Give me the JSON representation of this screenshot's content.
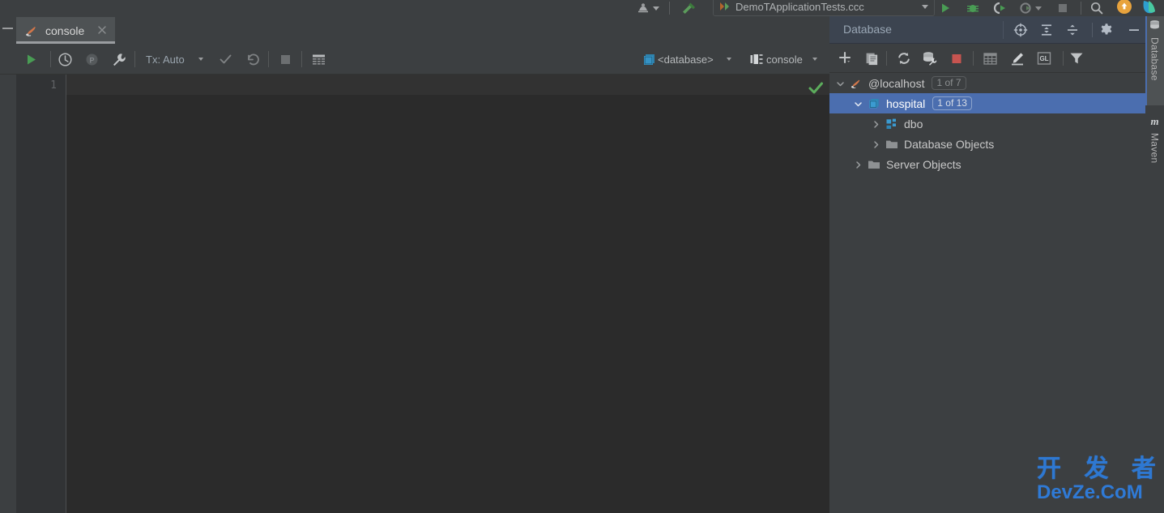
{
  "window": {
    "top_toolbar": {
      "profiler_icon": "profiler-icon",
      "build_icon": "build-hammer-icon",
      "run_config": {
        "name": "DemoTApplicationTests.ccc",
        "dropdown": "chevron-down-icon"
      },
      "run_icon": "run-icon",
      "debug_icon": "debug-icon",
      "coverage_icon": "run-with-coverage-icon",
      "profile_icon": "run-with-profiler-icon",
      "stop_icon": "stop-icon",
      "search_icon": "search-everywhere-icon",
      "updates_icon": "update-badge-icon",
      "app_icon": "application-icon"
    }
  },
  "console": {
    "tab": {
      "label": "console",
      "icon": "mssql-datasource-icon",
      "close": "close-icon"
    },
    "toolbar": {
      "execute": "execute-run-icon",
      "history": "history-clock-icon",
      "pause": "pause-parameters-icon",
      "settings": "wrench-icon",
      "tx_label": "Tx: Auto",
      "tx_caret": "chevron-down-icon",
      "commit": "commit-check-icon",
      "rollback": "rollback-icon",
      "stop": "stop-square-icon",
      "table_view": "open-tables-icon",
      "database_label": "<database>",
      "database_icon": "schema-stack-icon",
      "database_caret": "chevron-down-icon",
      "session_label": "console",
      "session_icon": "session-icon",
      "session_caret": "chevron-down-icon"
    },
    "editor": {
      "line_numbers": [
        "1"
      ],
      "text": "",
      "inspection_status": "ok-check-icon"
    }
  },
  "database_panel": {
    "title": "Database",
    "header_actions": [
      {
        "name": "scroll-from-source-icon"
      },
      {
        "name": "expand-all-icon"
      },
      {
        "name": "collapse-all-icon"
      },
      {
        "name": "settings-gear-icon"
      },
      {
        "name": "hide-minimize-icon"
      }
    ],
    "toolbar_actions": [
      {
        "name": "add-new-icon"
      },
      {
        "name": "duplicate-icon"
      },
      {
        "name": "refresh-icon"
      },
      {
        "name": "synchronize-schema-icon"
      },
      {
        "name": "stop-refresh-icon"
      },
      {
        "name": "jump-to-query-console-icon"
      },
      {
        "name": "modify-object-icon"
      },
      {
        "name": "open-gl-console-icon"
      },
      {
        "name": "filter-icon"
      }
    ],
    "tree": [
      {
        "label": "@localhost",
        "badge": "1 of 7",
        "icon": "mssql-datasource-icon",
        "twisty": "expanded",
        "indent": 0,
        "selected": false
      },
      {
        "label": "hospital",
        "badge": "1 of 13",
        "icon": "database-schema-icon",
        "twisty": "expanded",
        "indent": 1,
        "selected": true
      },
      {
        "label": "dbo",
        "badge": "",
        "icon": "schema-icon",
        "twisty": "collapsed",
        "indent": 2,
        "selected": false
      },
      {
        "label": "Database Objects",
        "badge": "",
        "icon": "folder-icon",
        "twisty": "collapsed",
        "indent": 2,
        "selected": false
      },
      {
        "label": "Server Objects",
        "badge": "",
        "icon": "folder-icon",
        "twisty": "collapsed",
        "indent": 1,
        "selected": false
      }
    ]
  },
  "right_tool_strip": [
    {
      "label": "Database",
      "icon": "database-stack-icon",
      "active": true
    },
    {
      "label": "Maven",
      "icon": "maven-m-icon",
      "active": false
    }
  ],
  "watermark": {
    "cn": "开 发 者",
    "en": "DevZe.CoM"
  },
  "colors": {
    "accent_selection": "#4b6eaf",
    "panel_bg": "#3c3f41",
    "editor_bg": "#2b2b2b",
    "gutter_bg": "#313335",
    "db_header_bg": "#3c4450",
    "run_green": "#499c54",
    "stop_red": "#c75450",
    "schema_blue": "#3592c4",
    "watermark_blue": "#2e78d2"
  }
}
